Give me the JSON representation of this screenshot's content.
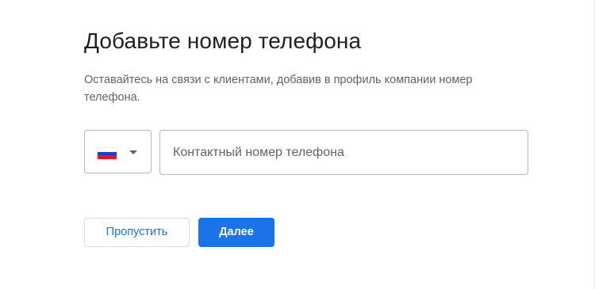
{
  "dialog": {
    "title": "Добавьте номер телефона",
    "subtitle": "Оставайтесь на связи с клиентами, добавив в профиль компании номер телефона."
  },
  "country_select": {
    "flag_icon": "russia-flag-icon",
    "flag_colors": [
      "#ffffff",
      "#1c3fd1",
      "#e0182a"
    ],
    "chevron_icon": "chevron-down-icon"
  },
  "phone_input": {
    "value": "",
    "placeholder": "Контактный номер телефона"
  },
  "actions": {
    "skip_label": "Пропустить",
    "next_label": "Далее"
  },
  "colors": {
    "accent": "#1a73e8",
    "text_primary": "#202124",
    "text_secondary": "#5f6368",
    "border": "#b8b8b8"
  }
}
